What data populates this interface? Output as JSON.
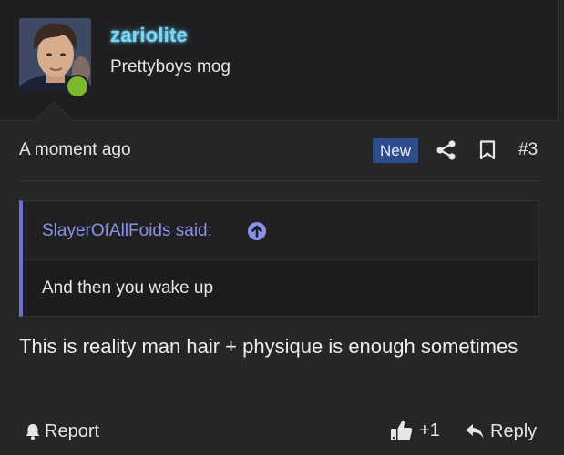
{
  "user": {
    "username": "zariolite",
    "title": "Prettyboys mog",
    "online": true,
    "username_color": "#7fd4f0",
    "online_color": "#7cb82f"
  },
  "post": {
    "timestamp": "A moment ago",
    "new_badge": "New",
    "number": "#3",
    "quote": {
      "author_label": "SlayerOfAllFoids said:",
      "text": "And then you wake up"
    },
    "message": "This is reality man hair + physique is enough sometimes"
  },
  "actions": {
    "report": "Report",
    "like_count": "+1",
    "reply": "Reply"
  },
  "icons": {
    "share": "share-icon",
    "bookmark": "bookmark-icon",
    "quote_jump": "arrow-up-circle-icon",
    "report": "bell-icon",
    "like": "thumbs-up-icon",
    "reply": "reply-arrow-icon"
  },
  "colors": {
    "background": "#262628",
    "accent_quote": "#6c73c9",
    "badge": "#2e4b8a"
  }
}
